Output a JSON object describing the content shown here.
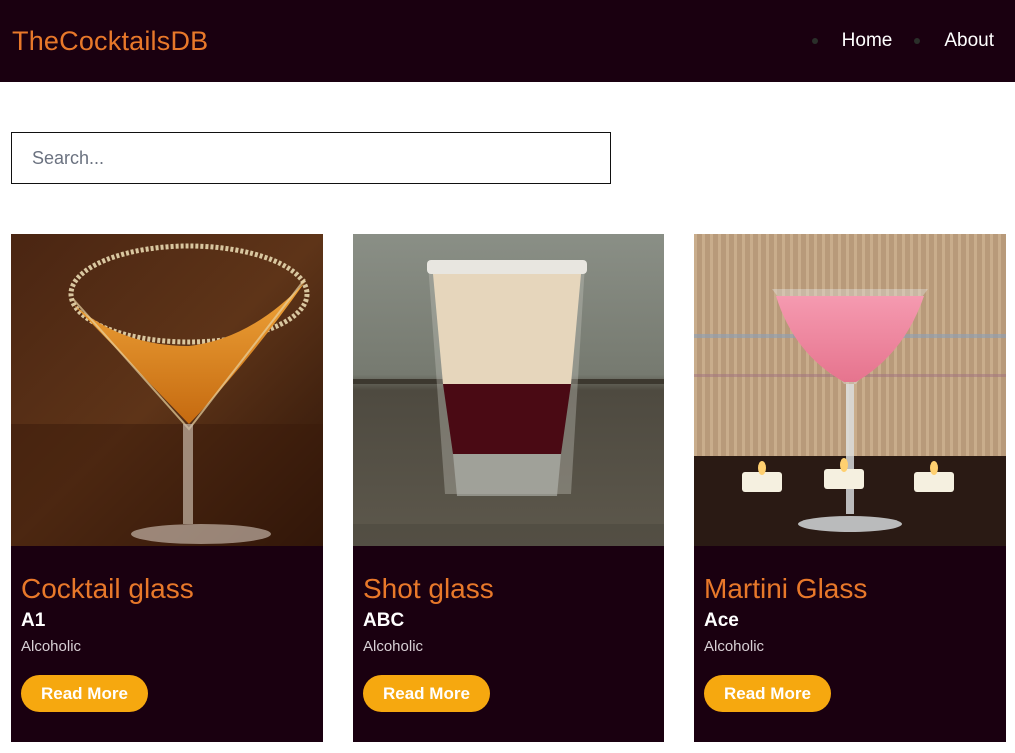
{
  "navbar": {
    "brand": "TheCocktailsDB",
    "links": [
      {
        "label": "Home"
      },
      {
        "label": "About"
      }
    ]
  },
  "search": {
    "placeholder": "Search...",
    "value": ""
  },
  "cards": [
    {
      "glass": "Cocktail glass",
      "name": "A1",
      "type": "Alcoholic",
      "button": "Read More",
      "photo": "cocktail-glass-photo"
    },
    {
      "glass": "Shot glass",
      "name": "ABC",
      "type": "Alcoholic",
      "button": "Read More",
      "photo": "shot-glass-photo"
    },
    {
      "glass": "Martini Glass",
      "name": "Ace",
      "type": "Alcoholic",
      "button": "Read More",
      "photo": "martini-glass-photo"
    }
  ],
  "colors": {
    "navbar_bg": "#1a0010",
    "brand": "#e8782a",
    "button": "#f6a80f",
    "card_bg": "#1a0010"
  }
}
